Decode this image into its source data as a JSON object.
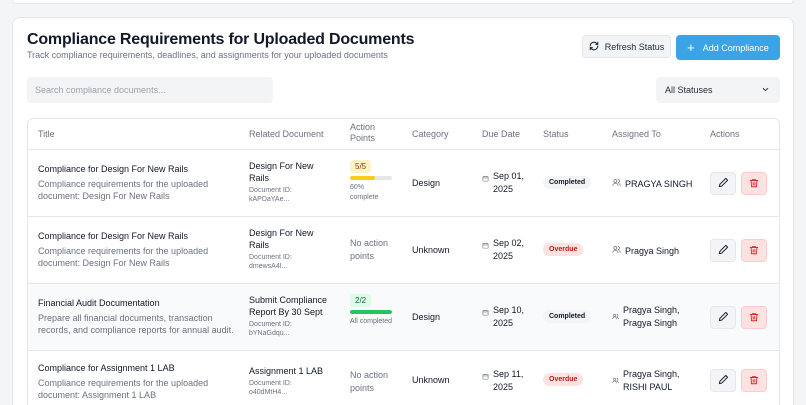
{
  "header": {
    "title": "Compliance Requirements for Uploaded Documents",
    "subtitle": "Track compliance requirements, deadlines, and assignments for your uploaded documents",
    "refresh_label": "Refresh Status",
    "add_label": "Add Compliance"
  },
  "search": {
    "placeholder": "Search compliance documents...",
    "value": ""
  },
  "filter": {
    "selected": "All Statuses"
  },
  "table": {
    "columns": {
      "title": "Title",
      "related": "Related Document",
      "action_points": "Action Points",
      "category": "Category",
      "due": "Due Date",
      "status": "Status",
      "assigned": "Assigned To",
      "actions": "Actions"
    },
    "rows": [
      {
        "title": "Compliance for Design For New Rails",
        "description": "Compliance requirements for the uploaded document: Design For New Rails",
        "doc_name": "Design For New Rails",
        "doc_id": "Document ID: kAPDaYAe...",
        "ap_count": "5/5",
        "ap_progress": 0.6,
        "ap_text": "60% complete",
        "category": "Design",
        "due": "Sep 01, 2025",
        "status": "Completed",
        "assigned": "PRAGYA SINGH"
      },
      {
        "title": "Compliance for Design For New Rails",
        "description": "Compliance requirements for the uploaded document: Design For New Rails",
        "doc_name": "Design For New Rails",
        "doc_id": "Document ID: dmewsA4I...",
        "no_action": "No action points",
        "category": "Unknown",
        "due": "Sep 02, 2025",
        "status": "Overdue",
        "assigned": "Pragya Singh"
      },
      {
        "title": "Financial Audit Documentation",
        "description": "Prepare all financial documents, transaction records, and compliance reports for annual audit.",
        "doc_name": "Submit Compliance Report By 30 Sept",
        "doc_id": "Document ID: bYNaGdqu...",
        "ap_count": "2/2",
        "ap_progress": 1.0,
        "ap_text": "All completed",
        "category": "Design",
        "due": "Sep 10, 2025",
        "status": "Completed",
        "assigned": "Pragya Singh, Pragya Singh"
      },
      {
        "title": "Compliance for Assignment 1 LAB",
        "description": "Compliance requirements for the uploaded document: Assignment 1 LAB",
        "doc_name": "Assignment 1 LAB",
        "doc_id": "Document ID: o40dMtH4...",
        "no_action": "No action points",
        "category": "Unknown",
        "due": "Sep 11, 2025",
        "status": "Overdue",
        "assigned": "Pragya Singh, RISHI PAUL"
      }
    ]
  },
  "colors": {
    "accent": "#3ba4e6",
    "progress_partial": "#facc15",
    "progress_complete": "#22c55e",
    "overdue": "#b91c1c",
    "delete": "#dc2626"
  },
  "icons": {
    "refresh": "refresh-icon",
    "add": "plus-icon",
    "select": "chevron-down-icon",
    "calendar": "calendar-icon",
    "users": "users-icon",
    "edit": "pencil-icon",
    "delete": "trash-icon"
  }
}
